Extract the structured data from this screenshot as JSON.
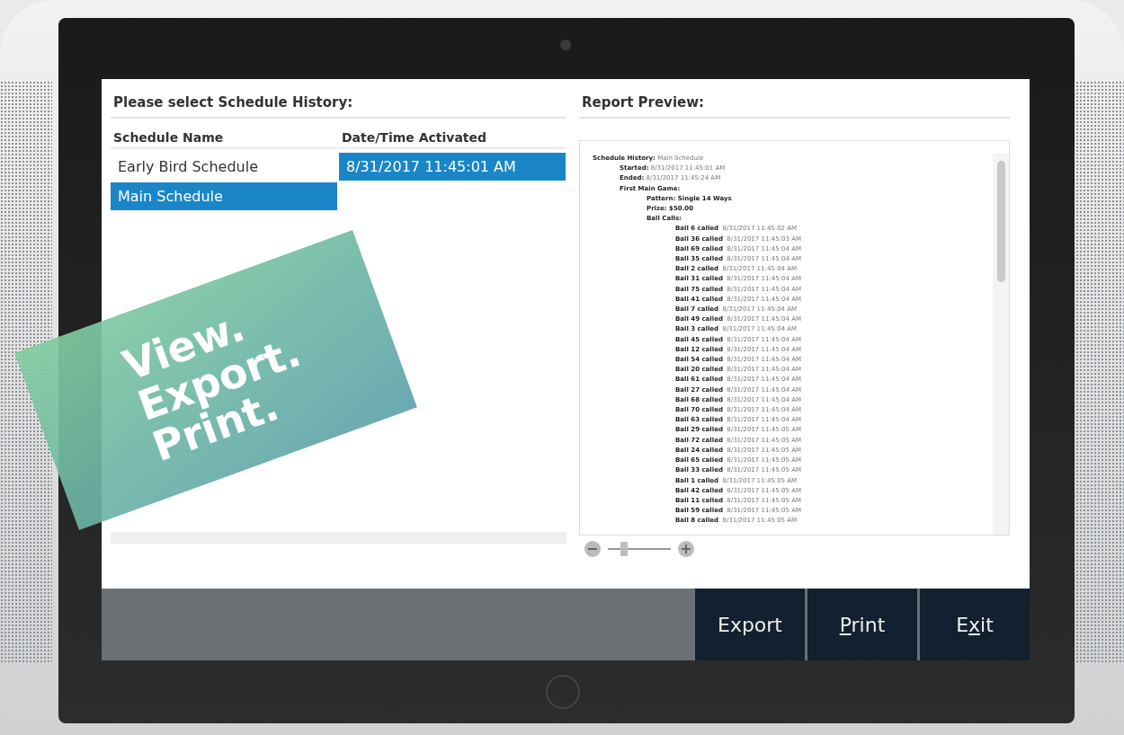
{
  "left_panel": {
    "title": "Please select Schedule History:",
    "columns": [
      "Schedule Name",
      "Date/Time Activated"
    ],
    "schedules": [
      {
        "name": "Early Bird Schedule",
        "selected": false
      },
      {
        "name": "Main Schedule",
        "selected": true
      }
    ],
    "activations": [
      {
        "time": "8/31/2017 11:45:01 AM",
        "selected": true
      }
    ]
  },
  "report_preview": {
    "title": "Report Preview:",
    "zoom": {
      "level": 0.25
    },
    "lines": [
      {
        "kind": "title",
        "label": "Schedule History:",
        "value": "Main Schedule"
      },
      {
        "kind": "field",
        "label": "Started:",
        "value": "8/31/2017 11:45:01 AM"
      },
      {
        "kind": "field",
        "label": "Ended:",
        "value": "8/31/2017 11:45:24 AM"
      },
      {
        "kind": "field",
        "label": "First Main Game:"
      },
      {
        "kind": "detail",
        "label": "Pattern: Single 14 Ways"
      },
      {
        "kind": "detail",
        "label": "Prize: $50.00"
      },
      {
        "kind": "detail",
        "label": "Ball Calls:"
      },
      {
        "kind": "ball",
        "label": "Ball 6 called",
        "value": "8/31/2017 11:45:02 AM"
      },
      {
        "kind": "ball",
        "label": "Ball 36 called",
        "value": "8/31/2017 11:45:03 AM"
      },
      {
        "kind": "ball",
        "label": "Ball 69 called",
        "value": "8/31/2017 11:45:04 AM"
      },
      {
        "kind": "ball",
        "label": "Ball 35 called",
        "value": "8/31/2017 11:45:04 AM"
      },
      {
        "kind": "ball",
        "label": "Ball 2 called",
        "value": "8/31/2017 11:45:04 AM"
      },
      {
        "kind": "ball",
        "label": "Ball 31 called",
        "value": "8/31/2017 11:45:04 AM"
      },
      {
        "kind": "ball",
        "label": "Ball 75 called",
        "value": "8/31/2017 11:45:04 AM"
      },
      {
        "kind": "ball",
        "label": "Ball 41 called",
        "value": "8/31/2017 11:45:04 AM"
      },
      {
        "kind": "ball",
        "label": "Ball 7 called",
        "value": "8/31/2017 11:45:04 AM"
      },
      {
        "kind": "ball",
        "label": "Ball 49 called",
        "value": "8/31/2017 11:45:04 AM"
      },
      {
        "kind": "ball",
        "label": "Ball 3 called",
        "value": "8/31/2017 11:45:04 AM"
      },
      {
        "kind": "ball",
        "label": "Ball 45 called",
        "value": "8/31/2017 11:45:04 AM"
      },
      {
        "kind": "ball",
        "label": "Ball 12 called",
        "value": "8/31/2017 11:45:04 AM"
      },
      {
        "kind": "ball",
        "label": "Ball 54 called",
        "value": "8/31/2017 11:45:04 AM"
      },
      {
        "kind": "ball",
        "label": "Ball 20 called",
        "value": "8/31/2017 11:45:04 AM"
      },
      {
        "kind": "ball",
        "label": "Ball 61 called",
        "value": "8/31/2017 11:45:04 AM"
      },
      {
        "kind": "ball",
        "label": "Ball 27 called",
        "value": "8/31/2017 11:45:04 AM"
      },
      {
        "kind": "ball",
        "label": "Ball 68 called",
        "value": "8/31/2017 11:45:04 AM"
      },
      {
        "kind": "ball",
        "label": "Ball 70 called",
        "value": "8/31/2017 11:45:04 AM"
      },
      {
        "kind": "ball",
        "label": "Ball 63 called",
        "value": "8/31/2017 11:45:04 AM"
      },
      {
        "kind": "ball",
        "label": "Ball 29 called",
        "value": "8/31/2017 11:45:05 AM"
      },
      {
        "kind": "ball",
        "label": "Ball 72 called",
        "value": "8/31/2017 11:45:05 AM"
      },
      {
        "kind": "ball",
        "label": "Ball 24 called",
        "value": "8/31/2017 11:45:05 AM"
      },
      {
        "kind": "ball",
        "label": "Ball 65 called",
        "value": "8/31/2017 11:45:05 AM"
      },
      {
        "kind": "ball",
        "label": "Ball 33 called",
        "value": "8/31/2017 11:45:05 AM"
      },
      {
        "kind": "ball",
        "label": "Ball 1 called",
        "value": "8/31/2017 11:45:05 AM"
      },
      {
        "kind": "ball",
        "label": "Ball 42 called",
        "value": "8/31/2017 11:45:05 AM"
      },
      {
        "kind": "ball",
        "label": "Ball 11 called",
        "value": "8/31/2017 11:45:05 AM"
      },
      {
        "kind": "ball",
        "label": "Ball 59 called",
        "value": "8/31/2017 11:45:05 AM"
      },
      {
        "kind": "ball",
        "label": "Ball 8 called",
        "value": "8/31/2017 11:45:05 AM"
      }
    ]
  },
  "buttons": [
    {
      "text_before": "Export"
    },
    {
      "access_key": "P",
      "text_after": "rint"
    },
    {
      "text_before": "E",
      "access_key": "x",
      "text_after": "it"
    }
  ],
  "banner": [
    "View.",
    "Export.",
    "Print."
  ]
}
